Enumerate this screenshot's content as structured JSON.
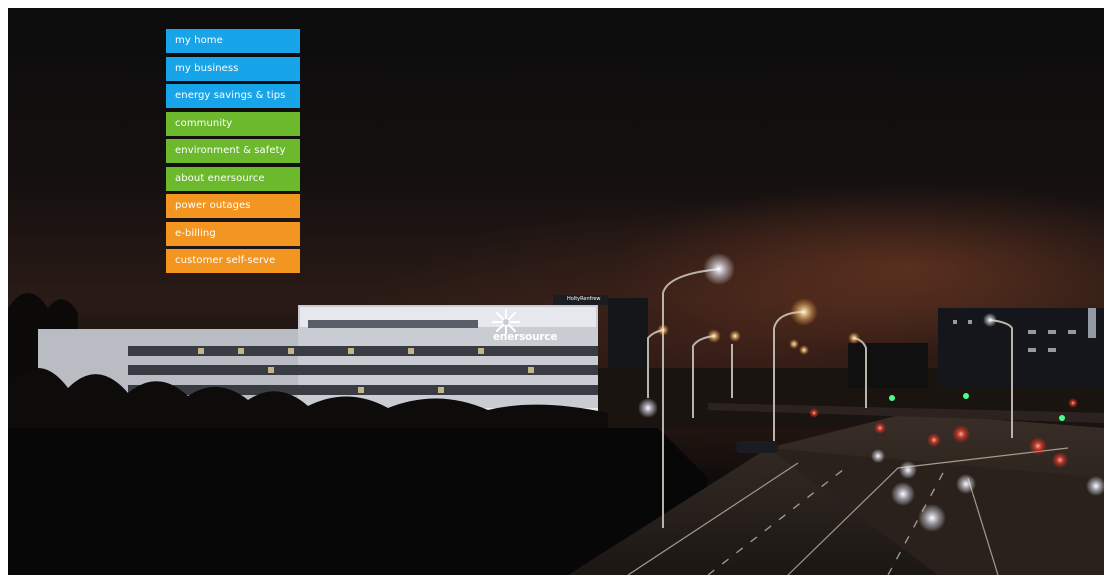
{
  "menu": {
    "items": [
      {
        "label": "my home",
        "color": "#18a4e8"
      },
      {
        "label": "my business",
        "color": "#18a4e8"
      },
      {
        "label": "energy savings & tips",
        "color": "#18a4e8"
      },
      {
        "label": "community",
        "color": "#6cb92d"
      },
      {
        "label": "environment & safety",
        "color": "#6cb92d"
      },
      {
        "label": "about enersource",
        "color": "#6cb92d"
      },
      {
        "label": "power outages",
        "color": "#f39521"
      },
      {
        "label": "e-billing",
        "color": "#f39521"
      },
      {
        "label": "customer self-serve",
        "color": "#f39521"
      }
    ]
  },
  "scene": {
    "building_sign": "enersource",
    "rooftop_sign": "HoltyRenfrew"
  }
}
